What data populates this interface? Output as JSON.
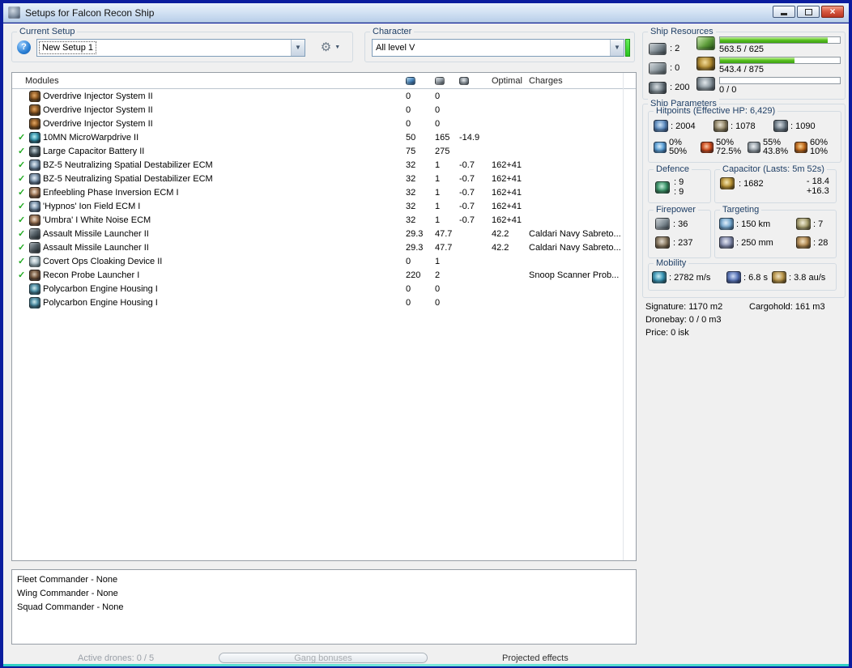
{
  "window": {
    "title": "Setups for Falcon Recon Ship"
  },
  "glyphs": {
    "dropdown": "▼",
    "check": "✓",
    "help": "?",
    "gear": "⚙",
    "close": "×"
  },
  "setup": {
    "group_label": "Current Setup",
    "value": "New Setup 1"
  },
  "character": {
    "group_label": "Character",
    "value": "All level V"
  },
  "modules": {
    "header_label": "Modules",
    "col_optimal": "Optimal",
    "col_charges": "Charges",
    "rows": [
      {
        "active": "",
        "icon": "overdrive",
        "name": "Overdrive Injector System II",
        "cpu": "0",
        "pg": "0",
        "cap": "",
        "optimal": "",
        "charges": ""
      },
      {
        "active": "",
        "icon": "overdrive",
        "name": "Overdrive Injector System II",
        "cpu": "0",
        "pg": "0",
        "cap": "",
        "optimal": "",
        "charges": ""
      },
      {
        "active": "",
        "icon": "overdrive",
        "name": "Overdrive Injector System II",
        "cpu": "0",
        "pg": "0",
        "cap": "",
        "optimal": "",
        "charges": ""
      },
      {
        "active": "✓",
        "icon": "mwd",
        "name": "10MN MicroWarpdrive II",
        "cpu": "50",
        "pg": "165",
        "cap": "-14.9",
        "optimal": "",
        "charges": ""
      },
      {
        "active": "✓",
        "icon": "capbattery",
        "name": "Large Capacitor Battery II",
        "cpu": "75",
        "pg": "275",
        "cap": "",
        "optimal": "",
        "charges": ""
      },
      {
        "active": "✓",
        "icon": "ecm",
        "name": "BZ-5 Neutralizing Spatial Destabilizer ECM",
        "cpu": "32",
        "pg": "1",
        "cap": "-0.7",
        "optimal": "162+41",
        "charges": ""
      },
      {
        "active": "✓",
        "icon": "ecm",
        "name": "BZ-5 Neutralizing Spatial Destabilizer ECM",
        "cpu": "32",
        "pg": "1",
        "cap": "-0.7",
        "optimal": "162+41",
        "charges": ""
      },
      {
        "active": "✓",
        "icon": "ecm2",
        "name": "Enfeebling Phase Inversion ECM I",
        "cpu": "32",
        "pg": "1",
        "cap": "-0.7",
        "optimal": "162+41",
        "charges": ""
      },
      {
        "active": "✓",
        "icon": "ecm",
        "name": "'Hypnos' Ion Field ECM I",
        "cpu": "32",
        "pg": "1",
        "cap": "-0.7",
        "optimal": "162+41",
        "charges": ""
      },
      {
        "active": "✓",
        "icon": "ecm2",
        "name": "'Umbra' I White Noise ECM",
        "cpu": "32",
        "pg": "1",
        "cap": "-0.7",
        "optimal": "162+41",
        "charges": ""
      },
      {
        "active": "✓",
        "icon": "missile",
        "name": "Assault Missile Launcher II",
        "cpu": "29.3",
        "pg": "47.7",
        "cap": "",
        "optimal": "42.2",
        "charges": "Caldari Navy Sabreto..."
      },
      {
        "active": "✓",
        "icon": "missile",
        "name": "Assault Missile Launcher II",
        "cpu": "29.3",
        "pg": "47.7",
        "cap": "",
        "optimal": "42.2",
        "charges": "Caldari Navy Sabreto..."
      },
      {
        "active": "✓",
        "icon": "cloak",
        "name": "Covert Ops Cloaking Device II",
        "cpu": "0",
        "pg": "1",
        "cap": "",
        "optimal": "",
        "charges": ""
      },
      {
        "active": "✓",
        "icon": "probe",
        "name": "Recon Probe Launcher I",
        "cpu": "220",
        "pg": "2",
        "cap": "",
        "optimal": "",
        "charges": "Snoop Scanner Prob..."
      },
      {
        "active": "",
        "icon": "rig",
        "name": "Polycarbon Engine Housing I",
        "cpu": "0",
        "pg": "0",
        "cap": "",
        "optimal": "",
        "charges": ""
      },
      {
        "active": "",
        "icon": "rig",
        "name": "Polycarbon Engine Housing I",
        "cpu": "0",
        "pg": "0",
        "cap": "",
        "optimal": "",
        "charges": ""
      }
    ]
  },
  "commanders": {
    "lines": [
      "Fleet Commander - None",
      "Wing Commander - None",
      "Squad Commander - None"
    ]
  },
  "statusbar": {
    "active_drones": "Active drones: 0 / 5",
    "gang_bonuses": "Gang bonuses",
    "projected_effects": "Projected effects"
  },
  "resources": {
    "group_label": "Ship Resources",
    "turrets": ": 2",
    "launchers": ": 0",
    "calibration": ": 200",
    "cpu": {
      "text": "563.5 / 625",
      "pct": 90
    },
    "powergrid": {
      "text": "543.4 / 875",
      "pct": 62
    },
    "drones": {
      "text": "0 / 0",
      "pct": 0
    }
  },
  "parameters": {
    "group_label": "Ship Parameters",
    "hitpoints": {
      "label": "Hitpoints (Effective HP: 6,429)",
      "shield": ": 2004",
      "armor": ": 1078",
      "structure": ": 1090",
      "resists": [
        {
          "icon": "em",
          "top": "0%",
          "bottom": "50%"
        },
        {
          "icon": "thermal",
          "top": "50%",
          "bottom": "72.5%"
        },
        {
          "icon": "kinetic",
          "top": "55%",
          "bottom": "43.8%"
        },
        {
          "icon": "explosive",
          "top": "60%",
          "bottom": "10%"
        }
      ]
    },
    "defence": {
      "label": "Defence",
      "top": ": 9",
      "bottom": ": 9"
    },
    "capacitor": {
      "label": "Capacitor (Lasts: 5m 52s)",
      "amount": ": 1682",
      "drain": "- 18.4",
      "recharge": "+16.3"
    },
    "firepower": {
      "label": "Firepower",
      "volley": ": 36",
      "dps": ": 237"
    },
    "targeting": {
      "label": "Targeting",
      "range": ": 150 km",
      "max_targets": ": 7",
      "scan_res": ": 250 mm",
      "sensor_strength": ": 28"
    },
    "mobility": {
      "label": "Mobility",
      "speed": ": 2782 m/s",
      "align": ": 6.8 s",
      "warp": ": 3.8 au/s"
    }
  },
  "summary": {
    "signature": "Signature: 1170 m2",
    "cargohold": "Cargohold: 161 m3",
    "dronebay": "Dronebay: 0 / 0 m3",
    "price": "Price: 0 isk"
  }
}
